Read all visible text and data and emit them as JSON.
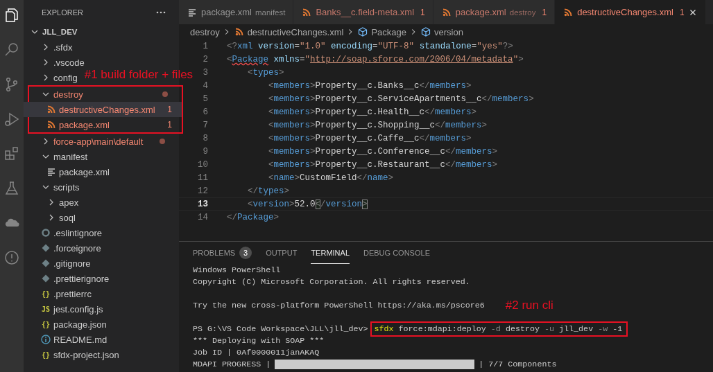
{
  "activity_bar": [
    {
      "kind": "files",
      "selected": true
    },
    {
      "kind": "search",
      "selected": false
    },
    {
      "kind": "source-control",
      "selected": false
    },
    {
      "kind": "run-debug",
      "selected": false
    },
    {
      "kind": "extensions",
      "selected": false
    },
    {
      "kind": "testing",
      "selected": false
    },
    {
      "kind": "cloud",
      "selected": false
    },
    {
      "kind": "problems",
      "selected": false
    }
  ],
  "sidebar": {
    "title": "EXPLORER",
    "root": {
      "name": "JLL_DEV",
      "expanded": true,
      "children": [
        {
          "name": ".sfdx",
          "kind": "folder",
          "expanded": false
        },
        {
          "name": ".vscode",
          "kind": "folder",
          "expanded": false
        },
        {
          "name": "config",
          "kind": "folder",
          "expanded": false,
          "note": "#1 build folder + files"
        },
        {
          "name": "destroy",
          "kind": "folder",
          "expanded": true,
          "problem": true,
          "dot": true,
          "outlined": true,
          "children": [
            {
              "name": "destructiveChanges.xml",
              "kind": "xml",
              "problem": true,
              "badge": "1",
              "selected": true
            },
            {
              "name": "package.xml",
              "kind": "xml",
              "problem": true,
              "badge": "1",
              "selected": false
            }
          ]
        },
        {
          "name": "force-app\\main\\default",
          "kind": "folder",
          "expanded": false,
          "problem": true,
          "dot": true
        },
        {
          "name": "manifest",
          "kind": "folder",
          "expanded": true,
          "children": [
            {
              "name": "package.xml",
              "kind": "manifest",
              "selected": false
            }
          ]
        },
        {
          "name": "scripts",
          "kind": "folder",
          "expanded": true,
          "children": [
            {
              "name": "apex",
              "kind": "folder",
              "expanded": false
            },
            {
              "name": "soql",
              "kind": "folder",
              "expanded": false
            }
          ]
        },
        {
          "name": ".eslintignore",
          "kind": "eslint",
          "selected": false
        },
        {
          "name": ".forceignore",
          "kind": "ignore",
          "selected": false
        },
        {
          "name": ".gitignore",
          "kind": "ignore",
          "selected": false
        },
        {
          "name": ".prettierignore",
          "kind": "ignore",
          "selected": false
        },
        {
          "name": ".prettierrc",
          "kind": "json",
          "icon_text": "{}",
          "selected": false
        },
        {
          "name": "jest.config.js",
          "kind": "js",
          "icon_text": "JS",
          "selected": false
        },
        {
          "name": "package.json",
          "kind": "json",
          "icon_text": "{}",
          "selected": false
        },
        {
          "name": "README.md",
          "kind": "readme",
          "selected": false
        },
        {
          "name": "sfdx-project.json",
          "kind": "json",
          "icon_text": "{}",
          "selected": false
        }
      ]
    }
  },
  "editor": {
    "tabs": [
      {
        "label": "package.xml",
        "description": "manifest",
        "kind": "manifest",
        "problem": false,
        "selected": false
      },
      {
        "label": "Banks__c.field-meta.xml",
        "badge": "1",
        "kind": "xml",
        "problem": true,
        "selected": false
      },
      {
        "label": "package.xml",
        "description": "destroy",
        "badge": "1",
        "kind": "xml",
        "problem": true,
        "selected": false
      },
      {
        "label": "destructiveChanges.xml",
        "badge": "1",
        "kind": "xml",
        "problem": true,
        "selected": true
      }
    ],
    "breadcrumbs": [
      {
        "label": "destroy",
        "kind": "folder"
      },
      {
        "label": "destructiveChanges.xml",
        "kind": "xml"
      },
      {
        "label": "Package",
        "kind": "element"
      },
      {
        "label": "version",
        "kind": "element"
      }
    ],
    "lines": [
      {
        "number": "1",
        "current": false,
        "tokens": [
          {
            "kind": "punct",
            "text": "<?"
          },
          {
            "kind": "tag",
            "text": "xml"
          },
          {
            "kind": "attr",
            "text": " version"
          },
          {
            "kind": "plain",
            "text": "="
          },
          {
            "kind": "string",
            "text": "\"1.0\""
          },
          {
            "kind": "attr",
            "text": " encoding"
          },
          {
            "kind": "plain",
            "text": "="
          },
          {
            "kind": "string",
            "text": "\"UTF-8\""
          },
          {
            "kind": "attr",
            "text": " standalone"
          },
          {
            "kind": "plain",
            "text": "="
          },
          {
            "kind": "string",
            "text": "\"yes\""
          },
          {
            "kind": "punct",
            "text": "?>"
          }
        ]
      },
      {
        "number": "2",
        "current": false,
        "tokens": [
          {
            "kind": "punct",
            "text": "<"
          },
          {
            "kind": "tag",
            "text": "Package",
            "error": true
          },
          {
            "kind": "attr",
            "text": " xmlns"
          },
          {
            "kind": "plain",
            "text": "="
          },
          {
            "kind": "string",
            "text": "\""
          },
          {
            "kind": "link",
            "text": "http://soap.sforce.com/2006/04/metadata"
          },
          {
            "kind": "string",
            "text": "\""
          },
          {
            "kind": "punct",
            "text": ">"
          }
        ],
        "children": [
          {
            "number": "3",
            "current": false,
            "tokens": [
              {
                "kind": "punct",
                "text": "<"
              },
              {
                "kind": "tag",
                "text": "types"
              },
              {
                "kind": "punct",
                "text": ">"
              }
            ],
            "children": [
              {
                "number": "4",
                "current": false,
                "tokens": [
                  {
                    "kind": "punct",
                    "text": "<"
                  },
                  {
                    "kind": "tag",
                    "text": "members"
                  },
                  {
                    "kind": "punct",
                    "text": ">"
                  },
                  {
                    "kind": "plain",
                    "text": "Property__c.Banks__c"
                  },
                  {
                    "kind": "punct",
                    "text": "</"
                  },
                  {
                    "kind": "tag",
                    "text": "members"
                  },
                  {
                    "kind": "punct",
                    "text": ">"
                  }
                ]
              },
              {
                "number": "5",
                "current": false,
                "tokens": [
                  {
                    "kind": "punct",
                    "text": "<"
                  },
                  {
                    "kind": "tag",
                    "text": "members"
                  },
                  {
                    "kind": "punct",
                    "text": ">"
                  },
                  {
                    "kind": "plain",
                    "text": "Property__c.ServiceApartments__c"
                  },
                  {
                    "kind": "punct",
                    "text": "</"
                  },
                  {
                    "kind": "tag",
                    "text": "members"
                  },
                  {
                    "kind": "punct",
                    "text": ">"
                  }
                ]
              },
              {
                "number": "6",
                "current": false,
                "tokens": [
                  {
                    "kind": "punct",
                    "text": "<"
                  },
                  {
                    "kind": "tag",
                    "text": "members"
                  },
                  {
                    "kind": "punct",
                    "text": ">"
                  },
                  {
                    "kind": "plain",
                    "text": "Property__c.Health__c"
                  },
                  {
                    "kind": "punct",
                    "text": "</"
                  },
                  {
                    "kind": "tag",
                    "text": "members"
                  },
                  {
                    "kind": "punct",
                    "text": ">"
                  }
                ]
              },
              {
                "number": "7",
                "current": false,
                "tokens": [
                  {
                    "kind": "punct",
                    "text": "<"
                  },
                  {
                    "kind": "tag",
                    "text": "members"
                  },
                  {
                    "kind": "punct",
                    "text": ">"
                  },
                  {
                    "kind": "plain",
                    "text": "Property__c.Shopping__c"
                  },
                  {
                    "kind": "punct",
                    "text": "</"
                  },
                  {
                    "kind": "tag",
                    "text": "members"
                  },
                  {
                    "kind": "punct",
                    "text": ">"
                  }
                ]
              },
              {
                "number": "8",
                "current": false,
                "tokens": [
                  {
                    "kind": "punct",
                    "text": "<"
                  },
                  {
                    "kind": "tag",
                    "text": "members"
                  },
                  {
                    "kind": "punct",
                    "text": ">"
                  },
                  {
                    "kind": "plain",
                    "text": "Property__c.Caffe__c"
                  },
                  {
                    "kind": "punct",
                    "text": "</"
                  },
                  {
                    "kind": "tag",
                    "text": "members"
                  },
                  {
                    "kind": "punct",
                    "text": ">"
                  }
                ]
              },
              {
                "number": "9",
                "current": false,
                "tokens": [
                  {
                    "kind": "punct",
                    "text": "<"
                  },
                  {
                    "kind": "tag",
                    "text": "members"
                  },
                  {
                    "kind": "punct",
                    "text": ">"
                  },
                  {
                    "kind": "plain",
                    "text": "Property__c.Conference__c"
                  },
                  {
                    "kind": "punct",
                    "text": "</"
                  },
                  {
                    "kind": "tag",
                    "text": "members"
                  },
                  {
                    "kind": "punct",
                    "text": ">"
                  }
                ]
              },
              {
                "number": "10",
                "current": false,
                "tokens": [
                  {
                    "kind": "punct",
                    "text": "<"
                  },
                  {
                    "kind": "tag",
                    "text": "members"
                  },
                  {
                    "kind": "punct",
                    "text": ">"
                  },
                  {
                    "kind": "plain",
                    "text": "Property__c.Restaurant__c"
                  },
                  {
                    "kind": "punct",
                    "text": "</"
                  },
                  {
                    "kind": "tag",
                    "text": "members"
                  },
                  {
                    "kind": "punct",
                    "text": ">"
                  }
                ]
              },
              {
                "number": "11",
                "current": false,
                "tokens": [
                  {
                    "kind": "punct",
                    "text": "<"
                  },
                  {
                    "kind": "tag",
                    "text": "name"
                  },
                  {
                    "kind": "punct",
                    "text": ">"
                  },
                  {
                    "kind": "plain",
                    "text": "CustomField"
                  },
                  {
                    "kind": "punct",
                    "text": "</"
                  },
                  {
                    "kind": "tag",
                    "text": "name"
                  },
                  {
                    "kind": "punct",
                    "text": ">"
                  }
                ]
              }
            ]
          },
          {
            "number": "12",
            "current": false,
            "tokens": [
              {
                "kind": "punct",
                "text": "</"
              },
              {
                "kind": "tag",
                "text": "types"
              },
              {
                "kind": "punct",
                "text": ">"
              }
            ]
          },
          {
            "number": "13",
            "current": true,
            "tokens": [
              {
                "kind": "punct",
                "text": "<"
              },
              {
                "kind": "tag",
                "text": "version"
              },
              {
                "kind": "punct",
                "text": ">"
              },
              {
                "kind": "plain",
                "text": "52.0"
              },
              {
                "kind": "punct",
                "text": "<",
                "match": true
              },
              {
                "kind": "punct",
                "text": "/"
              },
              {
                "kind": "tag",
                "text": "version"
              },
              {
                "kind": "punct",
                "text": ">",
                "match": true
              }
            ]
          }
        ]
      },
      {
        "number": "14",
        "current": false,
        "tokens": [
          {
            "kind": "punct",
            "text": "</"
          },
          {
            "kind": "tag",
            "text": "Package"
          },
          {
            "kind": "punct",
            "text": ">"
          }
        ]
      }
    ]
  },
  "panel": {
    "tabs": [
      {
        "label": "PROBLEMS",
        "badge": "3",
        "selected": false
      },
      {
        "label": "OUTPUT",
        "selected": false
      },
      {
        "label": "TERMINAL",
        "selected": true
      },
      {
        "label": "DEBUG CONSOLE",
        "selected": false
      }
    ],
    "terminal": [
      {
        "kind": "text",
        "text": "Windows PowerShell"
      },
      {
        "kind": "text",
        "text": "Copyright (C) Microsoft Corporation. All rights reserved."
      },
      {
        "kind": "blank"
      },
      {
        "kind": "text",
        "text": "Try the new cross-platform PowerShell https://aka.ms/pscore6",
        "note": "#2 run cli"
      },
      {
        "kind": "blank"
      },
      {
        "kind": "command",
        "prompt": "PS G:\\VS Code Workspace\\JLL\\jll_dev>",
        "outlined": true,
        "tokens": [
          {
            "kind": "exe",
            "text": "sfdx"
          },
          {
            "kind": "arg",
            "text": " force:mdapi:deploy "
          },
          {
            "kind": "flag",
            "text": "-d"
          },
          {
            "kind": "arg",
            "text": " destroy "
          },
          {
            "kind": "flag",
            "text": "-u"
          },
          {
            "kind": "arg",
            "text": " jll_dev "
          },
          {
            "kind": "flag",
            "text": "-w"
          },
          {
            "kind": "arg",
            "text": " -1"
          }
        ]
      },
      {
        "kind": "text",
        "text": "*** Deploying with SOAP ***"
      },
      {
        "kind": "text",
        "text": "Job ID | 0Af0000011janAKAQ"
      },
      {
        "kind": "progress",
        "label": "MDAPI PROGRESS |",
        "level": 1,
        "suffix": "| 7/7 Components"
      }
    ]
  }
}
